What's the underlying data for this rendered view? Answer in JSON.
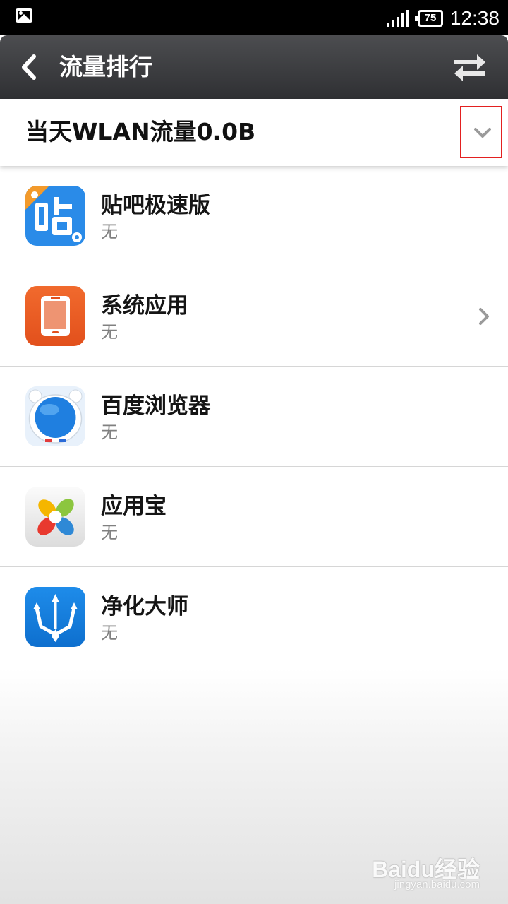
{
  "status_bar": {
    "battery": "75",
    "time": "12:38",
    "icons": [
      "gallery-icon",
      "signal-icon",
      "battery-icon"
    ]
  },
  "action_bar": {
    "title": "流量排行",
    "back_icon": "back-arrow-icon",
    "swap_icon": "swap-arrows-icon"
  },
  "summary": {
    "text": "当天WLAN流量0.0B",
    "dropdown_icon": "chevron-down-icon",
    "highlight_color": "#e32020"
  },
  "apps": [
    {
      "name": "贴吧极速版",
      "usage": "无",
      "icon": "tieba-app-icon",
      "has_chevron": false
    },
    {
      "name": "系统应用",
      "usage": "无",
      "icon": "system-app-icon",
      "has_chevron": true
    },
    {
      "name": "百度浏览器",
      "usage": "无",
      "icon": "baidu-browser-icon",
      "has_chevron": false
    },
    {
      "name": "应用宝",
      "usage": "无",
      "icon": "yingyongbao-icon",
      "has_chevron": false
    },
    {
      "name": "净化大师",
      "usage": "无",
      "icon": "jinghua-dashi-icon",
      "has_chevron": false
    }
  ],
  "watermark": {
    "brand": "Baidu经验",
    "url": "jingyan.baidu.com"
  }
}
